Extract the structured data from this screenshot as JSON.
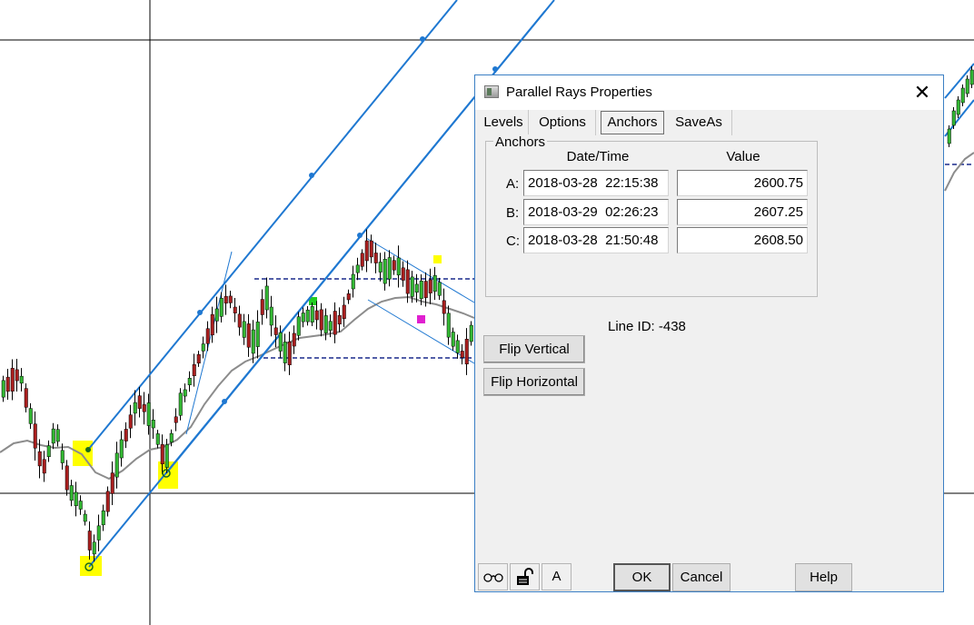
{
  "chart": {
    "line_color": "#1f78d1",
    "ma_color": "#8c8c8c",
    "bull_color": "#33b833",
    "bear_color": "#aa1f1f",
    "highlight_color": "#ffff00",
    "level_line_color": "#1a2a8c"
  },
  "dialog": {
    "title": "Parallel Rays Properties",
    "close_glyph": "✕",
    "tabs": [
      "Levels",
      "Options",
      "Anchors",
      "SaveAs"
    ],
    "active_tab": "Anchors",
    "group_label": "Anchors",
    "columns": {
      "datetime": "Date/Time",
      "value": "Value"
    },
    "anchors": [
      {
        "label": "A:",
        "datetime": "2018-03-28  22:15:38",
        "value": "2600.75"
      },
      {
        "label": "B:",
        "datetime": "2018-03-29  02:26:23",
        "value": "2607.25"
      },
      {
        "label": "C:",
        "datetime": "2018-03-28  21:50:48",
        "value": "2608.50"
      }
    ],
    "line_id": "Line ID: -438",
    "flip_vertical": "Flip Vertical",
    "flip_horizontal": "Flip Horizontal",
    "bottom": {
      "glasses_icon": "glasses-icon",
      "lock_icon": "unlock-icon",
      "font_button": "A",
      "ok": "OK",
      "cancel": "Cancel",
      "help": "Help"
    }
  }
}
